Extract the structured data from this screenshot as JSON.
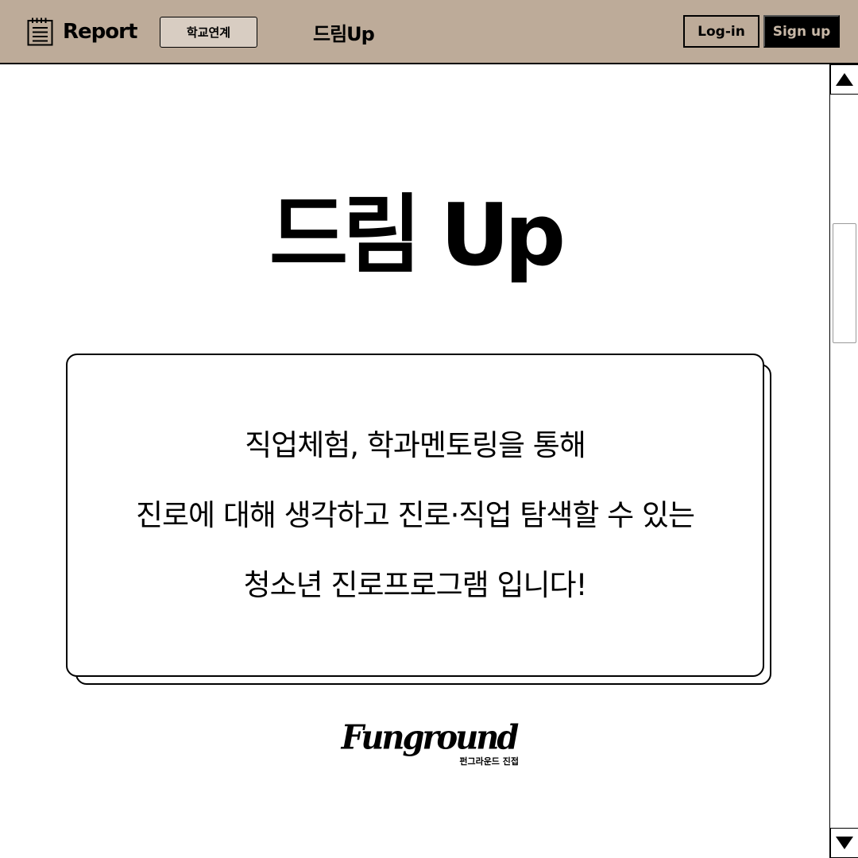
{
  "header": {
    "report_label": "Report",
    "report_icon": "notepad-icon",
    "school_button_label": "학교연계",
    "brand_label": "드림Up",
    "login_label": "Log-in",
    "signup_label": "Sign up",
    "background_color": "#bdab99"
  },
  "hero": {
    "title": "드림 Up"
  },
  "card": {
    "lines": [
      "직업체험, 학과멘토링을 통해",
      "진로에 대해 생각하고 진로·직업 탐색할 수 있는",
      "청소년 진로프로그램 입니다!"
    ]
  },
  "footer": {
    "logo_text": "Funground",
    "logo_subtitle": "펀그라운드 진접"
  },
  "scrollbar": {
    "up_icon": "triangle-up-icon",
    "down_icon": "triangle-down-icon"
  }
}
